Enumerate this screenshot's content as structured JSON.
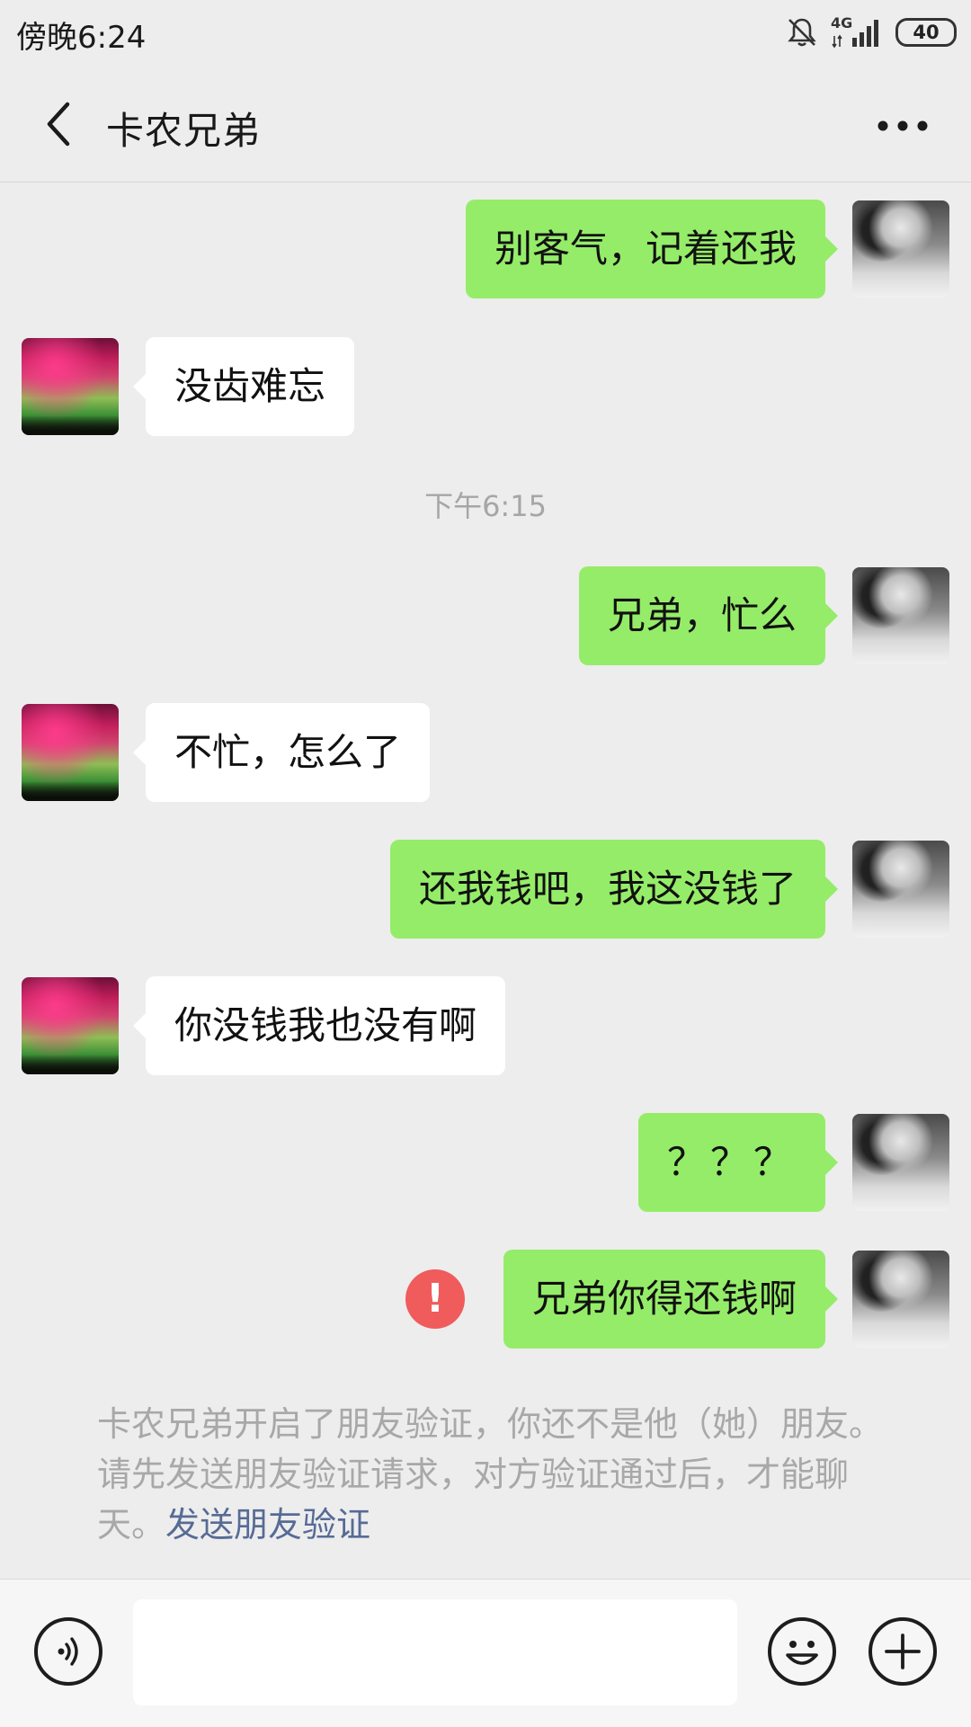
{
  "status_bar": {
    "time": "傍晚6:24",
    "network": "4G",
    "battery": "40",
    "icons": [
      "mute-bell-icon",
      "signal-icon",
      "battery-icon"
    ]
  },
  "header": {
    "title": "卡农兄弟",
    "back_icon": "chevron-left-icon",
    "more_icon": "more-dots-icon"
  },
  "messages": [
    {
      "side": "right",
      "text": "别客气，记着还我"
    },
    {
      "side": "left",
      "text": "没齿难忘"
    },
    {
      "side": "timestamp",
      "text": "下午6:15"
    },
    {
      "side": "right",
      "text": "兄弟，忙么"
    },
    {
      "side": "left",
      "text": "不忙，怎么了"
    },
    {
      "side": "right",
      "text": "还我钱吧，我这没钱了"
    },
    {
      "side": "left",
      "text": "你没钱我也没有啊"
    },
    {
      "side": "right",
      "text": "？？？"
    },
    {
      "side": "right",
      "text": "兄弟你得还钱啊",
      "failed": true,
      "error_icon_text": "!"
    }
  ],
  "system_notice": {
    "text": "卡农兄弟开启了朋友验证，你还不是他（她）朋友。请先发送朋友验证请求，对方验证通过后，才能聊天。",
    "link": "发送朋友验证"
  },
  "input_bar": {
    "voice_icon": "voice-icon",
    "emoji_icon": "emoji-icon",
    "plus_icon": "plus-icon",
    "value": ""
  },
  "colors": {
    "background": "#ededed",
    "bubble_sent": "#95ec69",
    "bubble_received": "#ffffff",
    "error": "#f05b5b",
    "link": "#576b95"
  }
}
